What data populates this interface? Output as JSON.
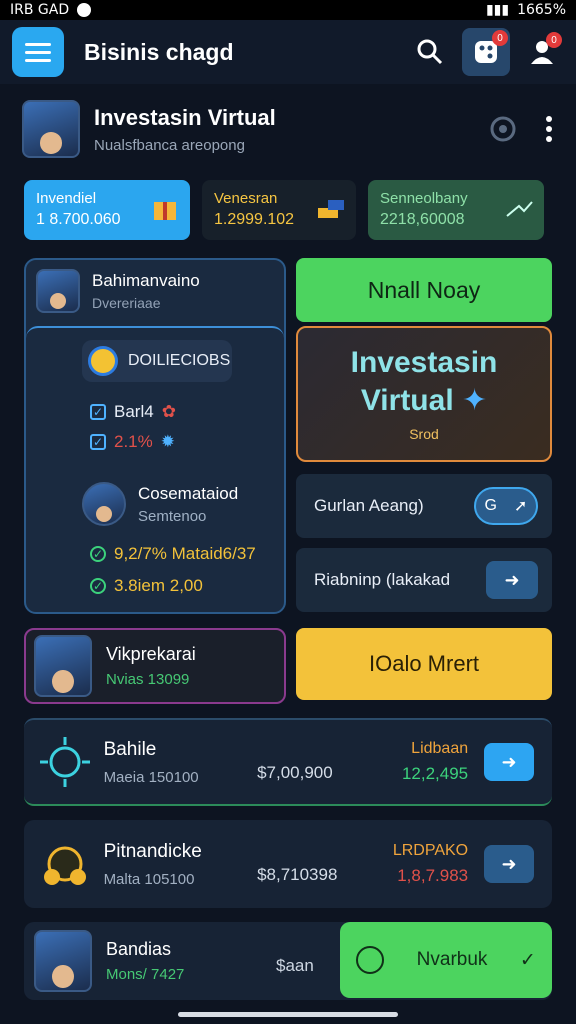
{
  "status_bar": {
    "left": "IRB GAD",
    "right": "1665%"
  },
  "header": {
    "title": "Bisinis chagd",
    "notif_count": "0",
    "badge_count": "0"
  },
  "profile": {
    "name": "Investasin Virtual",
    "subtitle": "Nualsfbanca areopong"
  },
  "stats": [
    {
      "label": "Invendiel",
      "value": "1 8.700.060"
    },
    {
      "label": "Venesran",
      "value": "1.2999.102"
    },
    {
      "label": "Senneolbany",
      "value": "2218,60008"
    }
  ],
  "left_panel": {
    "name": "Bahimanvaino",
    "subtitle": "Dvereriaae",
    "pill_label": "DOILIECIOBS",
    "checks": [
      "Barl4",
      "2.1%"
    ],
    "person_name": "Cosemataiod",
    "person_sub": "Semtenoo",
    "lines": [
      "9,2/7% Mataid6/37",
      "3.8iem 2,00"
    ]
  },
  "right_col": {
    "green_button": "Nnall Noay",
    "card_title_1": "Investasin",
    "card_title_2": "Virtual",
    "card_sub": "Srod",
    "row1_label": "Gurlan Aeang)",
    "row1_toggle": "G",
    "row2_label": "Riabninp (lakakad"
  },
  "vip": {
    "name": "Vikprekarai",
    "subtitle": "Nvias 13099"
  },
  "yellow_button": "IOalo Mrert",
  "assets": [
    {
      "name": "Bahile",
      "sub": "Maeia 150100",
      "price": "$7,00,900",
      "change_label": "Lidbaan",
      "change_value": "12,2,495",
      "change_color": "#3cd27c"
    },
    {
      "name": "Pitnandicke",
      "sub": "Malta 105100",
      "price": "$8,710398",
      "change_label": "LRDPAKO",
      "change_value": "1,8,7.983",
      "change_color": "#e0514a"
    }
  ],
  "last_row": {
    "name": "Bandias",
    "sub": "Mons/ 7427",
    "price": "$aan",
    "button": "Nvarbuk"
  }
}
